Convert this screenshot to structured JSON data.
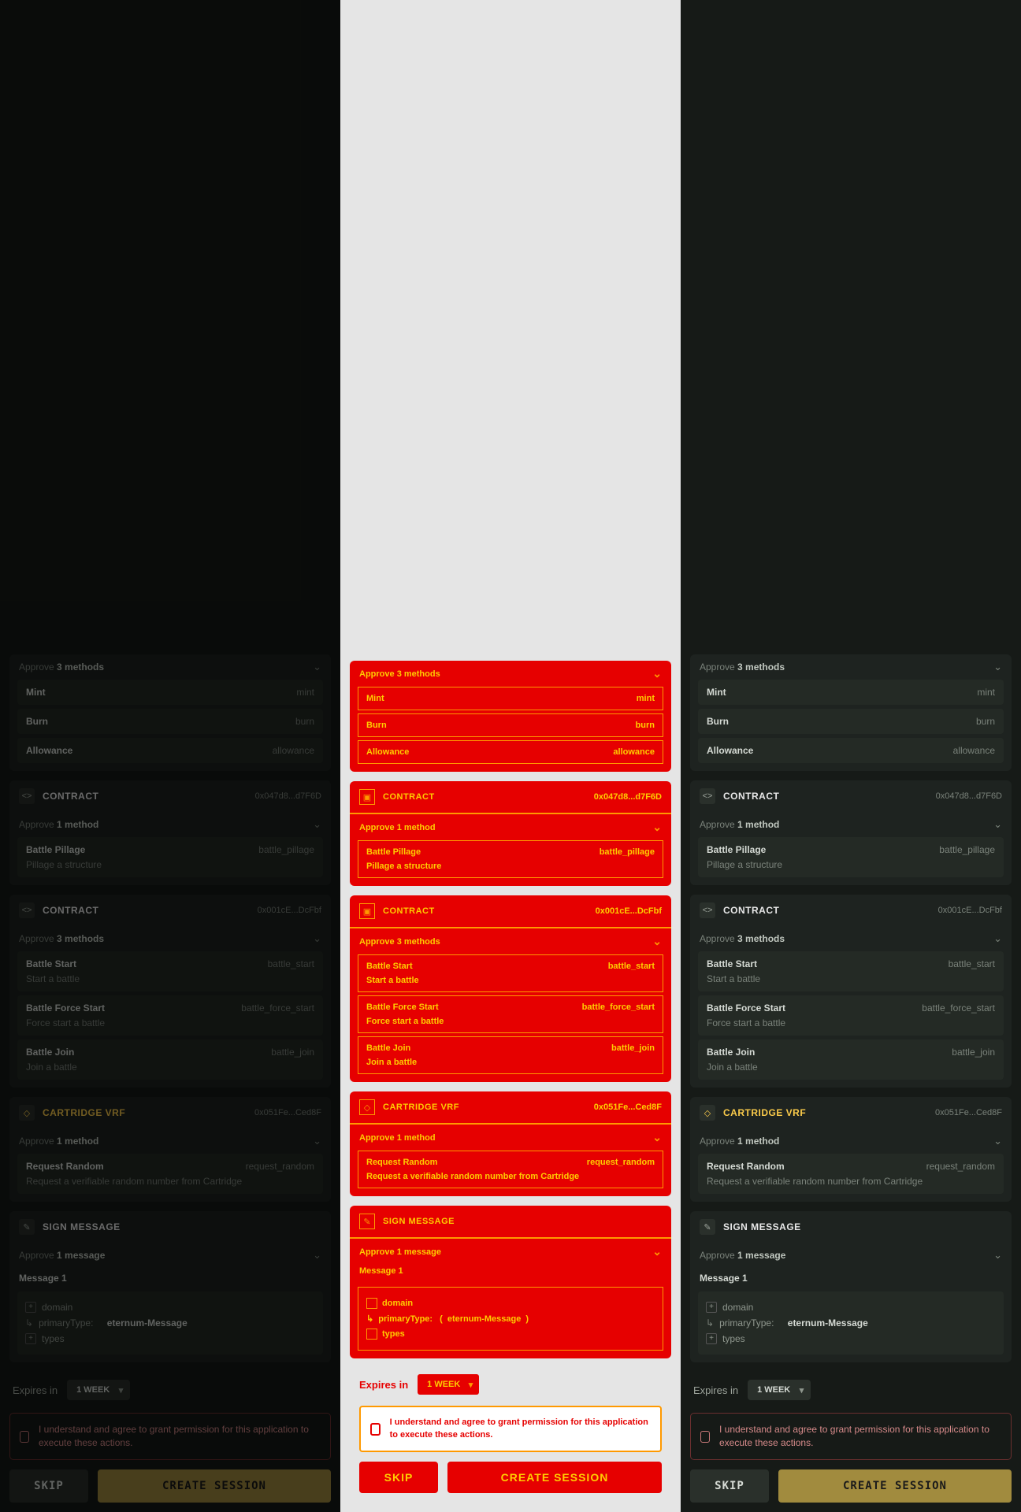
{
  "approve_methods_prefix": "Approve ",
  "approve_method_prefix": "Approve ",
  "approve_message_prefix": "Approve ",
  "count_3_methods": "3 methods",
  "count_1_method": "1 method",
  "count_1_message": "1 message",
  "contract_label": "CONTRACT",
  "cartridge_vrf_label": "CARTRIDGE VRF",
  "sign_message_label": "SIGN MESSAGE",
  "addr1": "0x047d8...d7F6D",
  "addr2": "0x001cE...DcFbf",
  "addr3": "0x051Fe...Ced8F",
  "m_mint": {
    "name": "Mint",
    "slug": "mint"
  },
  "m_burn": {
    "name": "Burn",
    "slug": "burn"
  },
  "m_allowance": {
    "name": "Allowance",
    "slug": "allowance"
  },
  "m_pillage": {
    "name": "Battle Pillage",
    "slug": "battle_pillage",
    "desc": "Pillage a structure"
  },
  "m_start": {
    "name": "Battle Start",
    "slug": "battle_start",
    "desc": "Start a battle"
  },
  "m_force": {
    "name": "Battle Force Start",
    "slug": "battle_force_start",
    "desc": "Force start a battle"
  },
  "m_join": {
    "name": "Battle Join",
    "slug": "battle_join",
    "desc": "Join a battle"
  },
  "m_random": {
    "name": "Request Random",
    "slug": "request_random",
    "desc": "Request a verifiable random number from Cartridge"
  },
  "message1": "Message 1",
  "tree_domain": "domain",
  "tree_primary_label": "primaryType:",
  "tree_primary_value": "eternum-Message",
  "tree_types": "types",
  "expires_label": "Expires in",
  "expires_value": "1 WEEK",
  "agree_text": "I understand and agree to grant permission for this application to execute these actions.",
  "btn_skip": "SKIP",
  "btn_create": "CREATE SESSION"
}
